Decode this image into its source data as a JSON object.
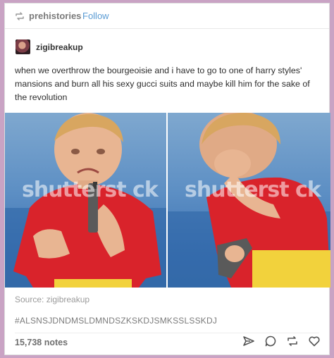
{
  "header": {
    "reblogged_from": "prehistories",
    "follow_label": "Follow"
  },
  "post": {
    "author": "zigibreakup",
    "text": "when we overthrow the bourgeoisie and i have to go to one of harry styles' mansions and burn all his sexy gucci suits and maybe kill him for the sake of the revolution",
    "images": [
      {
        "watermark": "shutterst ck"
      },
      {
        "watermark": "shutterst ck"
      }
    ],
    "source": "Source: zigibreakup",
    "tag": "#ALSNSJDNDMSLDMNDSZKSKDJSMKSSLSSKDJ"
  },
  "footer": {
    "notes": "15,738 notes",
    "actions": [
      "share-icon",
      "reply-icon",
      "reblog-icon",
      "like-icon"
    ]
  },
  "colors": {
    "background": "#c9a3c4",
    "follow": "#5a9bd4",
    "shirt": "#d9232b",
    "shorts": "#f2d23c"
  }
}
